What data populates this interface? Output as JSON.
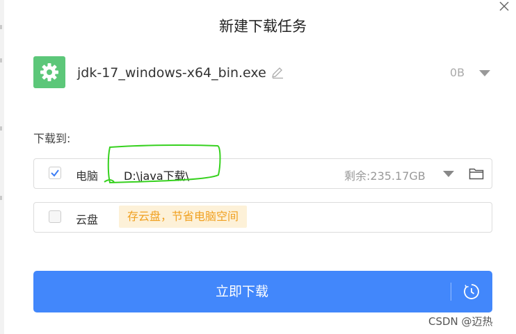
{
  "dialog": {
    "title": "新建下载任务",
    "file_name": "jdk-17_windows-x64_bin.exe",
    "file_size": "0B",
    "download_to_label": "下载到:",
    "button_label": "立即下载"
  },
  "locations": {
    "pc": {
      "label": "电脑",
      "path": "D:\\java下载\\",
      "free_space": "剩余:235.17GB",
      "checked": true
    },
    "cloud": {
      "label": "云盘",
      "promo": "存云盘，节省电脑空间",
      "checked": false
    }
  },
  "colors": {
    "primary": "#4287fb",
    "file_icon_bg": "#5cc779",
    "promo_bg": "#fdf1d8",
    "promo_text": "#f0a020",
    "annotation": "#36d11e"
  },
  "icons": {
    "file": "gear-icon",
    "edit": "pencil-icon",
    "folder": "folder-icon",
    "close": "close-icon",
    "schedule": "clock-icon"
  },
  "watermark": "CSDN @迈热"
}
